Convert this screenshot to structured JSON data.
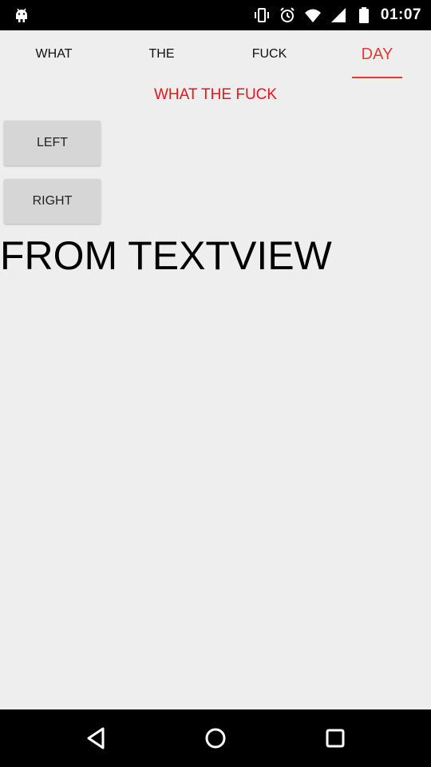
{
  "status_bar": {
    "time": "01:07",
    "icons": [
      "android-icon",
      "vibrate-icon",
      "alarm-icon",
      "wifi-icon",
      "signal-icon",
      "battery-icon"
    ]
  },
  "tabs": [
    {
      "label": "WHAT",
      "active": false
    },
    {
      "label": "THE",
      "active": false
    },
    {
      "label": "FUCK",
      "active": false
    },
    {
      "label": "DAY",
      "active": true
    }
  ],
  "content": {
    "subtitle": "WHAT THE FUCK",
    "left_button": "LEFT",
    "right_button": "RIGHT",
    "textview": "FROM TEXTVIEW"
  },
  "nav_bar": {
    "icons": [
      "back-icon",
      "home-icon",
      "recents-icon"
    ]
  },
  "colors": {
    "accent": "#e53935",
    "subtitle": "#e8141b",
    "background": "#eeeeee",
    "button": "#d6d6d6"
  }
}
